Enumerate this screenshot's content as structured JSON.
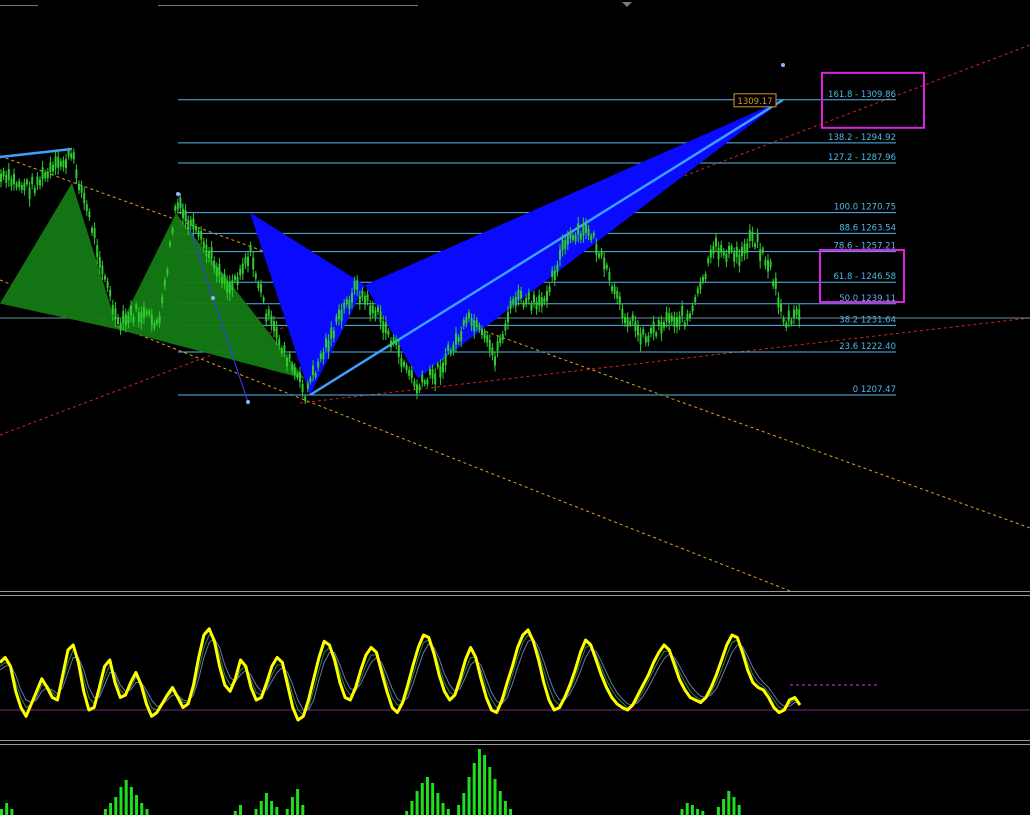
{
  "chart_data": [
    {
      "type": "candlestick",
      "panel": "price",
      "colors": {
        "candles": "#2ecc2e",
        "bat_pattern_fill": "#0a0aff",
        "prior_pattern_fill": "#137a13",
        "pattern_leg": "#3ea0ff",
        "fib_levels": "#52b8ea",
        "channel_red": "#d22222",
        "channel_orange": "#e0a020",
        "price_line": "#6a8ea0",
        "highlight_box": "#e020e0",
        "price_tag": "#d7972f"
      },
      "fibonacci_levels": [
        {
          "label": "161.8 -  1309.86",
          "price": 1309.86
        },
        {
          "label": "138.2 - 1294.92",
          "price": 1294.92
        },
        {
          "label": "127.2 - 1287.96",
          "price": 1287.96
        },
        {
          "label": "100.0 1270.75",
          "price": 1270.75
        },
        {
          "label": "88.6 1263.54",
          "price": 1263.54
        },
        {
          "label": "78.6 - 1257.21",
          "price": 1257.21
        },
        {
          "label": "61.8 - 1246.58",
          "price": 1246.58
        },
        {
          "label": "50.0 1239.11",
          "price": 1239.11
        },
        {
          "label": "38.2 1231.64",
          "price": 1231.64
        },
        {
          "label": "23.6 1222.40",
          "price": 1222.4
        },
        {
          "label": "0 1207.47",
          "price": 1207.47
        }
      ],
      "highlighted_levels": [
        "161.8",
        "61.8",
        "50.0"
      ],
      "price_tag": "1309.17",
      "bat_pattern_prices": {
        "X": 1270.75,
        "A": 1207.47,
        "B": 1245.6,
        "C": 1213.2,
        "D": 1309.86
      },
      "prior_pattern_prices": {
        "X": 1239.2,
        "A": 1281.0,
        "B": 1230.2,
        "C": 1270.5,
        "D": 1213.0
      }
    },
    {
      "type": "line",
      "panel": "stochastic oscillator",
      "series": [
        {
          "color": "#ffff00",
          "values": [
            58,
            62,
            55,
            35,
            22,
            15,
            25,
            35,
            45,
            38,
            30,
            28,
            48,
            68,
            72,
            58,
            35,
            20,
            22,
            38,
            55,
            60,
            42,
            30,
            32,
            42,
            50,
            40,
            25,
            15,
            18,
            25,
            32,
            38,
            30,
            22,
            25,
            40,
            62,
            80,
            85,
            75,
            55,
            40,
            35,
            45,
            60,
            55,
            38,
            28,
            30,
            42,
            55,
            62,
            58,
            40,
            22,
            12,
            15,
            28,
            45,
            62,
            75,
            72,
            60,
            42,
            30,
            28,
            38,
            52,
            64,
            70,
            66,
            50,
            35,
            22,
            18,
            26,
            40,
            56,
            70,
            80,
            78,
            65,
            48,
            35,
            28,
            32,
            45,
            60,
            70,
            62,
            45,
            30,
            20,
            18,
            28,
            42,
            55,
            70,
            80,
            84,
            75,
            60,
            42,
            28,
            20,
            22,
            30,
            40,
            52,
            66,
            76,
            72,
            60,
            48,
            38,
            30,
            25,
            22,
            20,
            24,
            32,
            40,
            48,
            58,
            66,
            72,
            68,
            56,
            44,
            36,
            30,
            28,
            26,
            30,
            38,
            48,
            60,
            72,
            80,
            78,
            66,
            52,
            42,
            38,
            36,
            30,
            22,
            18,
            20,
            28,
            30,
            24
          ]
        },
        {
          "color": "#2a8a3a",
          "values": [
            55,
            58,
            56,
            42,
            30,
            22,
            24,
            30,
            40,
            40,
            34,
            30,
            42,
            58,
            68,
            62,
            45,
            30,
            25,
            32,
            46,
            56,
            48,
            36,
            32,
            38,
            46,
            42,
            32,
            22,
            20,
            24,
            30,
            35,
            32,
            26,
            26,
            35,
            52,
            70,
            80,
            78,
            64,
            48,
            40,
            42,
            52,
            55,
            44,
            34,
            32,
            38,
            48,
            56,
            56,
            46,
            32,
            20,
            16,
            22,
            36,
            52,
            66,
            70,
            64,
            50,
            38,
            32,
            35,
            45,
            56,
            64,
            64,
            55,
            42,
            30,
            24,
            24,
            34,
            48,
            62,
            74,
            76,
            68,
            55,
            42,
            34,
            32,
            40,
            52,
            62,
            62,
            52,
            38,
            28,
            22,
            25,
            35,
            48,
            62,
            74,
            80,
            76,
            66,
            52,
            38,
            28,
            24,
            28,
            36,
            46,
            58,
            70,
            72,
            64,
            54,
            44,
            36,
            30,
            26,
            22,
            23,
            28,
            35,
            43,
            52,
            60,
            67,
            67,
            60,
            50,
            42,
            35,
            31,
            28,
            29,
            34,
            42,
            52,
            64,
            74,
            76,
            70,
            58,
            48,
            42,
            39,
            34,
            28,
            22,
            21,
            25,
            28,
            26
          ]
        },
        {
          "color": "#6f6fb0",
          "values": [
            52,
            55,
            56,
            48,
            36,
            28,
            26,
            28,
            35,
            38,
            36,
            33,
            38,
            50,
            62,
            62,
            52,
            38,
            30,
            30,
            40,
            50,
            50,
            40,
            35,
            36,
            42,
            42,
            36,
            28,
            23,
            24,
            28,
            32,
            32,
            28,
            27,
            32,
            45,
            62,
            74,
            77,
            70,
            56,
            46,
            43,
            48,
            52,
            48,
            40,
            35,
            36,
            43,
            50,
            54,
            50,
            40,
            28,
            20,
            20,
            28,
            44,
            58,
            66,
            66,
            56,
            45,
            37,
            36,
            41,
            50,
            58,
            62,
            58,
            48,
            37,
            29,
            26,
            30,
            41,
            54,
            66,
            73,
            70,
            61,
            49,
            40,
            35,
            37,
            46,
            56,
            60,
            56,
            45,
            34,
            27,
            25,
            30,
            41,
            54,
            66,
            75,
            77,
            70,
            59,
            46,
            35,
            28,
            28,
            33,
            41,
            51,
            62,
            69,
            67,
            59,
            50,
            41,
            34,
            29,
            25,
            24,
            26,
            31,
            38,
            46,
            54,
            61,
            65,
            62,
            55,
            47,
            40,
            35,
            31,
            30,
            32,
            37,
            46,
            56,
            66,
            72,
            71,
            63,
            54,
            47,
            42,
            38,
            32,
            26,
            23,
            23,
            26,
            26
          ]
        }
      ],
      "level_line": 20
    },
    {
      "type": "bar",
      "panel": "volume histogram",
      "color": "#1fe01f",
      "values": [
        6,
        12,
        6,
        0,
        0,
        0,
        0,
        0,
        0,
        0,
        0,
        0,
        0,
        0,
        0,
        0,
        0,
        0,
        0,
        0,
        6,
        12,
        18,
        28,
        35,
        28,
        20,
        12,
        6,
        0,
        0,
        0,
        0,
        0,
        0,
        0,
        0,
        0,
        0,
        0,
        0,
        0,
        0,
        0,
        0,
        4,
        10,
        0,
        0,
        6,
        14,
        22,
        14,
        8,
        0,
        6,
        18,
        26,
        10,
        0,
        0,
        0,
        0,
        0,
        0,
        0,
        0,
        0,
        0,
        0,
        0,
        0,
        0,
        0,
        0,
        0,
        0,
        0,
        4,
        14,
        24,
        32,
        38,
        32,
        22,
        12,
        6,
        0,
        10,
        22,
        38,
        52,
        66,
        60,
        48,
        36,
        24,
        14,
        6,
        0,
        0,
        0,
        0,
        0,
        0,
        0,
        0,
        0,
        0,
        0,
        0,
        0,
        0,
        0,
        0,
        0,
        0,
        0,
        0,
        0,
        0,
        0,
        0,
        0,
        0,
        0,
        0,
        0,
        0,
        0,
        0,
        6,
        12,
        10,
        6,
        4,
        0,
        0,
        8,
        16,
        24,
        18,
        10,
        0,
        0,
        0,
        0,
        0,
        0,
        0,
        0,
        0,
        0,
        0,
        0
      ]
    }
  ]
}
